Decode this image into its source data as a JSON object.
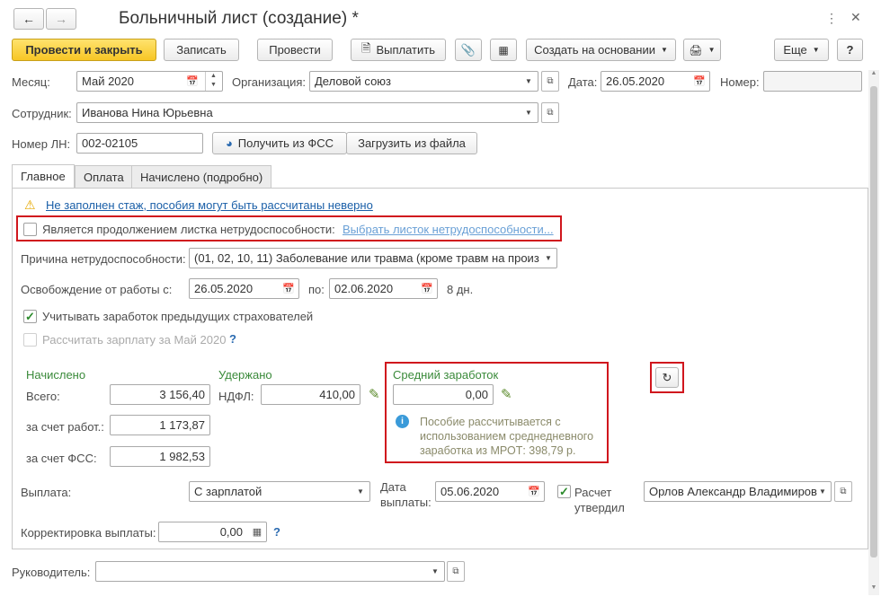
{
  "header": {
    "title": "Больничный лист (создание) *",
    "back_icon": "arrow-left-icon",
    "forward_icon": "arrow-right-icon",
    "menu_icon": "more-vertical-icon",
    "close_icon": "close-icon"
  },
  "toolbar": {
    "post_close": "Провести и закрыть",
    "save": "Записать",
    "post": "Провести",
    "pay": "Выплатить",
    "create_based": "Создать на основании",
    "more": "Еще",
    "help": "?"
  },
  "fields": {
    "month_label": "Месяц:",
    "month_value": "Май 2020",
    "org_label": "Организация:",
    "org_value": "Деловой союз",
    "date_label": "Дата:",
    "date_value": "26.05.2020",
    "number_label": "Номер:",
    "number_value": "",
    "employee_label": "Сотрудник:",
    "employee_value": "Иванова Нина Юрьевна",
    "ln_label": "Номер ЛН:",
    "ln_value": "002-02105",
    "get_fss": "Получить из ФСС",
    "load_file": "Загрузить из файла"
  },
  "tabs": [
    "Главное",
    "Оплата",
    "Начислено (подробно)"
  ],
  "main": {
    "warning_link": "Не заполнен стаж, пособия могут быть рассчитаны неверно",
    "continuation_label": "Является продолжением листка нетрудоспособности:",
    "continuation_checked": false,
    "select_sheet_link": "Выбрать листок нетрудоспособности...",
    "reason_label": "Причина нетрудоспособности:",
    "reason_value": "(01, 02, 10, 11) Заболевание или травма (кроме травм на произ",
    "release_label": "Освобождение от работы с:",
    "release_from": "26.05.2020",
    "release_to_label": "по:",
    "release_to": "02.06.2020",
    "days": "8 дн.",
    "prev_earnings_label": "Учитывать заработок предыдущих страхователей",
    "prev_earnings_checked": true,
    "calc_salary_label": "Рассчитать зарплату за Май 2020",
    "calc_salary_checked": false,
    "calc_salary_help": "?"
  },
  "accrued": {
    "heading": "Начислено",
    "total_label": "Всего:",
    "total_value": "3 156,40",
    "employer_label": "за счет работ.:",
    "employer_value": "1 173,87",
    "fss_label": "за счет ФСС:",
    "fss_value": "1 982,53"
  },
  "withheld": {
    "heading": "Удержано",
    "ndfl_label": "НДФЛ:",
    "ndfl_value": "410,00"
  },
  "average": {
    "heading": "Средний заработок",
    "value": "0,00",
    "info": "Пособие рассчитывается с использованием среднедневного заработка из МРОТ: 398,79 р."
  },
  "payment": {
    "label": "Выплата:",
    "value": "С зарплатой",
    "date_label": "Дата выплаты:",
    "date_value": "05.06.2020",
    "approved_label": "Расчет утвердил",
    "approved_checked": true,
    "approver_value": "Орлов Александр Владимиров",
    "correction_label": "Корректировка выплаты:",
    "correction_value": "0,00",
    "correction_help": "?"
  },
  "manager": {
    "label": "Руководитель:",
    "value": ""
  },
  "colors": {
    "accent_yellow": "#f7c625",
    "highlight_red": "#d0161d",
    "green_heading": "#3a8a3a",
    "link_blue": "#1a5fa8"
  }
}
